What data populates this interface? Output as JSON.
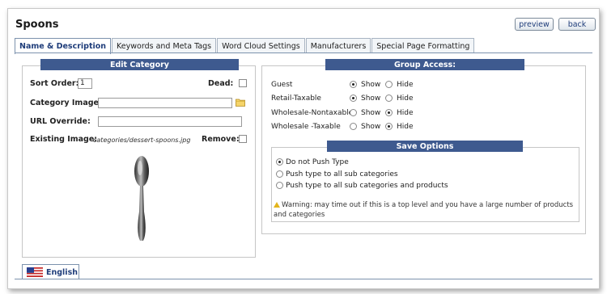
{
  "page": {
    "title": "Spoons"
  },
  "toolbar": {
    "preview_label": "preview",
    "back_label": "back"
  },
  "tabs": [
    {
      "label": "Name & Description",
      "active": true
    },
    {
      "label": "Keywords and Meta Tags",
      "active": false
    },
    {
      "label": "Word Cloud Settings",
      "active": false
    },
    {
      "label": "Manufacturers",
      "active": false
    },
    {
      "label": "Special Page Formatting",
      "active": false
    }
  ],
  "edit_category": {
    "heading": "Edit Category",
    "sort_order_label": "Sort Order:",
    "sort_order_value": "1",
    "dead_label": "Dead:",
    "dead_checked": false,
    "category_image_label": "Category Image:",
    "category_image_value": "",
    "url_override_label": "URL Override:",
    "url_override_value": "",
    "existing_image_label": "Existing Image:",
    "existing_image_path": "categories/dessert-spoons.jpg",
    "remove_label": "Remove:",
    "remove_checked": false
  },
  "group_access": {
    "heading": "Group Access:",
    "show_label": "Show",
    "hide_label": "Hide",
    "groups": [
      {
        "name": "Guest",
        "selected": "show"
      },
      {
        "name": "Retail-Taxable",
        "selected": "show"
      },
      {
        "name": "Wholesale-Nontaxable",
        "selected": "hide"
      },
      {
        "name": "Wholesale -Taxable",
        "selected": "hide"
      }
    ]
  },
  "save_options": {
    "heading": "Save Options",
    "options": [
      {
        "label": "Do not Push Type",
        "selected": true
      },
      {
        "label": "Push type to all sub categories",
        "selected": false
      },
      {
        "label": "Push type to all sub categories and products",
        "selected": false
      }
    ],
    "warning": "Warning: may time out if this is a top level and you have a large number of products and categories"
  },
  "language_tab": {
    "label": "English"
  },
  "colors": {
    "section_bar": "#3e5a8f",
    "link_text": "#1f3d7a",
    "warning_icon": "#e3b51c"
  },
  "icons": [
    "folder-icon",
    "warning-icon",
    "us-flag-icon"
  ]
}
